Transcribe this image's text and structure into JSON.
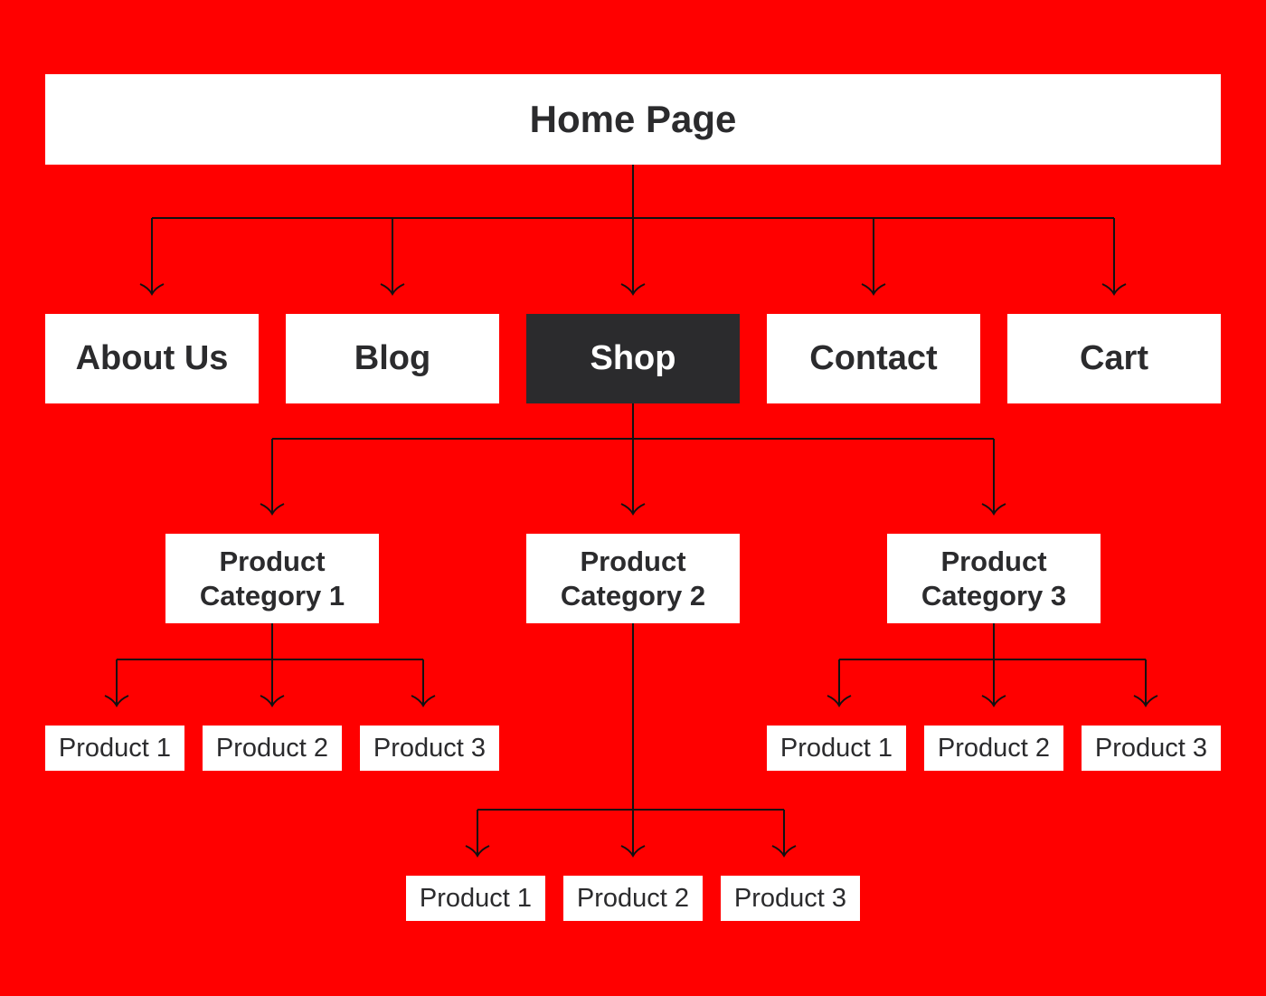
{
  "diagram": {
    "background_color": "#ff0000",
    "node_color": "#ffffff",
    "highlight_color": "#2b2b2d",
    "text_color": "#2b2b2d",
    "root": {
      "id": "home",
      "label": "Home Page"
    },
    "level1": [
      {
        "id": "about",
        "label": "About Us",
        "highlighted": false
      },
      {
        "id": "blog",
        "label": "Blog",
        "highlighted": false
      },
      {
        "id": "shop",
        "label": "Shop",
        "highlighted": true
      },
      {
        "id": "contact",
        "label": "Contact",
        "highlighted": false
      },
      {
        "id": "cart",
        "label": "Cart",
        "highlighted": false
      }
    ],
    "categories": [
      {
        "id": "cat1",
        "label": "Product Category 1",
        "line1": "Product",
        "line2": "Category 1",
        "parent": "shop",
        "products": [
          "Product 1",
          "Product 2",
          "Product 3"
        ]
      },
      {
        "id": "cat2",
        "label": "Product Category 2",
        "line1": "Product",
        "line2": "Category 2",
        "parent": "shop",
        "products": [
          "Product 1",
          "Product 2",
          "Product 3"
        ]
      },
      {
        "id": "cat3",
        "label": "Product Category 3",
        "line1": "Product",
        "line2": "Category 3",
        "parent": "shop",
        "products": [
          "Product 1",
          "Product 2",
          "Product 3"
        ]
      }
    ],
    "edges": [
      [
        "home",
        "about"
      ],
      [
        "home",
        "blog"
      ],
      [
        "home",
        "shop"
      ],
      [
        "home",
        "contact"
      ],
      [
        "home",
        "cart"
      ],
      [
        "shop",
        "cat1"
      ],
      [
        "shop",
        "cat2"
      ],
      [
        "shop",
        "cat3"
      ],
      [
        "cat1",
        "cat1-p1"
      ],
      [
        "cat1",
        "cat1-p2"
      ],
      [
        "cat1",
        "cat1-p3"
      ],
      [
        "cat2",
        "cat2-p1"
      ],
      [
        "cat2",
        "cat2-p2"
      ],
      [
        "cat2",
        "cat2-p3"
      ],
      [
        "cat3",
        "cat3-p1"
      ],
      [
        "cat3",
        "cat3-p2"
      ],
      [
        "cat3",
        "cat3-p3"
      ]
    ]
  }
}
